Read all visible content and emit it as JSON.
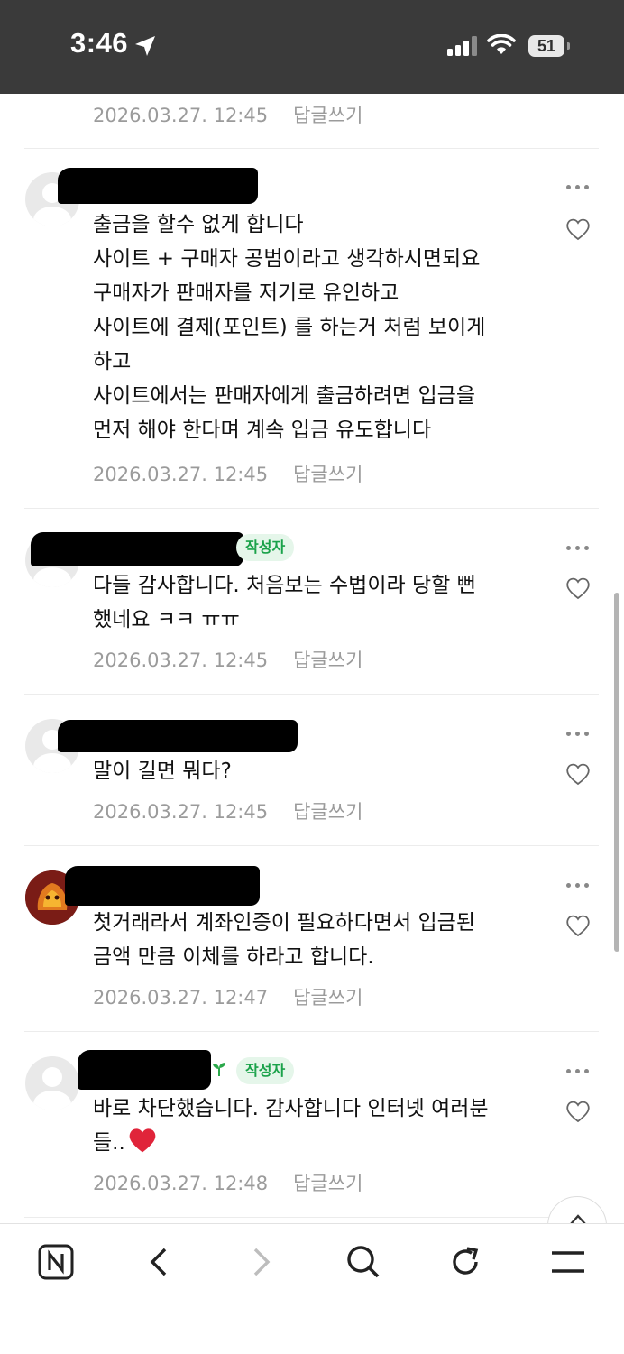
{
  "status_bar": {
    "time": "3:46",
    "battery": "51"
  },
  "top_meta": {
    "date": "2026.03.27. 12:45",
    "reply": "답글쓰기"
  },
  "comments": [
    {
      "lines": [
        "출금을 할수 없게 합니다",
        "사이트 + 구매자 공범이라고 생각하시면되요",
        "구매자가 판매자를 저기로 유인하고",
        "사이트에 결제(포인트) 를 하는거 처럼 보이게",
        "하고",
        "사이트에서는 판매자에게 출금하려면 입금을",
        "먼저 해야 한다며 계속 입금 유도합니다"
      ],
      "date": "2026.03.27. 12:45",
      "reply": "답글쓰기"
    },
    {
      "author_badge": "작성자",
      "lines": [
        "다들 감사합니다. 처음보는 수법이라 당할 뻔",
        "했네요 ㅋㅋ ㅠㅠ"
      ],
      "date": "2026.03.27. 12:45",
      "reply": "답글쓰기"
    },
    {
      "lines": [
        "말이 길면 뭐다?"
      ],
      "date": "2026.03.27. 12:45",
      "reply": "답글쓰기"
    },
    {
      "lines": [
        "첫거래라서 계좌인증이 필요하다면서 입금된",
        "금액 만큼 이체를 하라고 합니다."
      ],
      "date": "2026.03.27. 12:47",
      "reply": "답글쓰기"
    },
    {
      "author_badge": "작성자",
      "lines": [
        "바로 차단했습니다. 감사합니다 인터넷 여러분",
        "들.."
      ],
      "date": "2026.03.27. 12:48",
      "reply": "답글쓰기"
    }
  ],
  "icons": {
    "toolbar": [
      "naver-home-icon",
      "back-icon",
      "forward-icon",
      "search-icon",
      "refresh-icon",
      "menu-icon"
    ]
  },
  "colors": {
    "badge_bg": "#e5f6ea",
    "badge_text": "#1aa24a",
    "meta": "#9b9b9b",
    "status_bar": "#3a3a3a"
  }
}
